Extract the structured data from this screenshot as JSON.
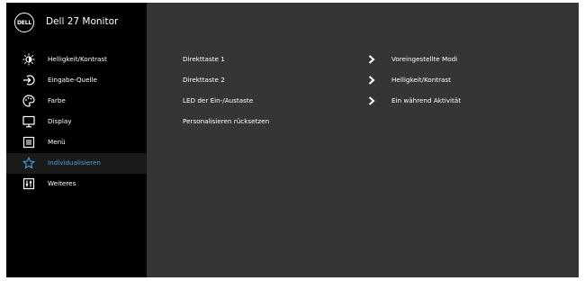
{
  "header": {
    "brand": "DELL",
    "title": "Dell 27 Monitor"
  },
  "sidebar": {
    "items": [
      {
        "label": "Helligkeit/Kontrast",
        "icon": "brightness-icon"
      },
      {
        "label": "Eingabe-Quelle",
        "icon": "input-source-icon"
      },
      {
        "label": "Farbe",
        "icon": "color-palette-icon"
      },
      {
        "label": "Display",
        "icon": "display-icon"
      },
      {
        "label": "Menü",
        "icon": "menu-icon"
      },
      {
        "label": "Individualisieren",
        "icon": "star-icon",
        "selected": true
      },
      {
        "label": "Weiteres",
        "icon": "others-icon"
      }
    ]
  },
  "content": {
    "rows": [
      {
        "label": "Direkttaste 1",
        "value": "Voreingestellte Modi"
      },
      {
        "label": "Direkttaste 2",
        "value": "Helligkeit/Kontrast"
      },
      {
        "label": "LED der Ein-/Austaste",
        "value": "Ein während Aktivität"
      },
      {
        "label": "Personalisieren rücksetzen",
        "value": ""
      }
    ]
  },
  "colors": {
    "sidebar_bg": "#000000",
    "panel_bg": "#353535",
    "accent": "#4a9fd8",
    "text": "#ffffff"
  }
}
